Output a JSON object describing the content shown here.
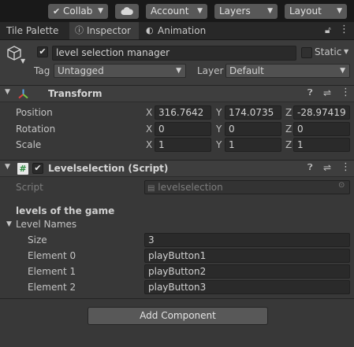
{
  "toolbar": {
    "collab_label": "Collab",
    "account_label": "Account",
    "layers_label": "Layers",
    "layout_label": "Layout"
  },
  "tabs": [
    {
      "label": "Tile Palette"
    },
    {
      "label": "Inspector"
    },
    {
      "label": "Animation"
    }
  ],
  "object": {
    "name": "level selection manager",
    "active": true,
    "static_label": "Static",
    "tag_label": "Tag",
    "tag_value": "Untagged",
    "layer_label": "Layer",
    "layer_value": "Default"
  },
  "transform": {
    "title": "Transform",
    "rows": [
      {
        "label": "Position",
        "x": "316.7642",
        "y": "174.0735",
        "z": "-28.97419"
      },
      {
        "label": "Rotation",
        "x": "0",
        "y": "0",
        "z": "0"
      },
      {
        "label": "Scale",
        "x": "1",
        "y": "1",
        "z": "1"
      }
    ],
    "axis_x": "X",
    "axis_y": "Y",
    "axis_z": "Z"
  },
  "script_component": {
    "title": "Levelselection (Script)",
    "script_label": "Script",
    "script_value": "levelselection",
    "header": "levels of the game",
    "list_label": "Level Names",
    "size_label": "Size",
    "size_value": "3",
    "elements": [
      {
        "label": "Element 0",
        "value": "playButton1"
      },
      {
        "label": "Element 1",
        "value": "playButton2"
      },
      {
        "label": "Element 2",
        "value": "playButton3"
      }
    ]
  },
  "add_component_label": "Add Component",
  "colors": {
    "accent_blue": "#4a90d9",
    "background": "#383838",
    "topbar": "#191919"
  }
}
